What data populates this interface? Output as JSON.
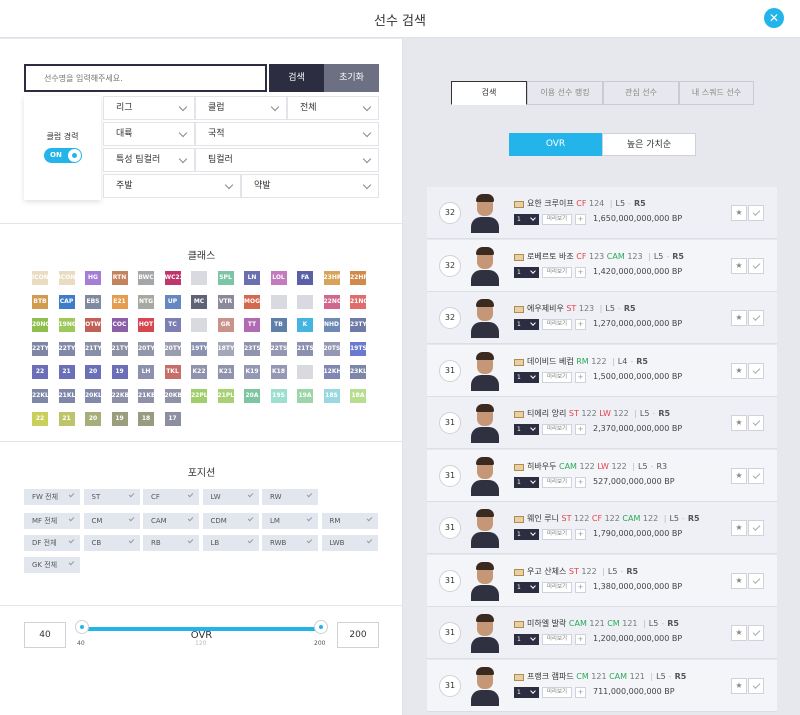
{
  "header": {
    "title": "선수 검색",
    "close_label": "✕"
  },
  "search": {
    "placeholder": "선수명을 입력해주세요.",
    "search_label": "검색",
    "reset_label": "초기화",
    "club_career_label": "클럽 경력",
    "club_career_toggle": "ON",
    "filters": {
      "league": "리그",
      "club": "클럽",
      "all": "전체",
      "continent": "대륙",
      "nationality": "국적",
      "special_team_color": "특성 팀컬러",
      "team_color": "팀컬러",
      "main_foot": "주발",
      "weak_foot": "약발"
    }
  },
  "class_section": {
    "title": "클래스",
    "badges": [
      {
        "label": "ICON",
        "color": "#e9dcc0"
      },
      {
        "label": "ICON",
        "color": "#e9dcc0"
      },
      {
        "label": "HG",
        "color": "#a67dd6"
      },
      {
        "label": "RTN",
        "color": "#c4825e"
      },
      {
        "label": "BWC",
        "color": "#a4a6a8"
      },
      {
        "label": "WC22",
        "color": "#c0356b"
      },
      {
        "label": "",
        "color": "#d9dadf"
      },
      {
        "label": "SPL",
        "color": "#7ec4a6"
      },
      {
        "label": "LN",
        "color": "#6870b0"
      },
      {
        "label": "LOL",
        "color": "#c27bbd"
      },
      {
        "label": "FA",
        "color": "#5a60a8"
      },
      {
        "label": "23HR",
        "color": "#d8a35a"
      },
      {
        "label": "22HR",
        "color": "#d08a4a"
      },
      {
        "label": "BTB",
        "color": "#d29a4e"
      },
      {
        "label": "CAP",
        "color": "#3e7cc8"
      },
      {
        "label": "EBS",
        "color": "#7f8aa0"
      },
      {
        "label": "E21",
        "color": "#e59e50"
      },
      {
        "label": "NTG",
        "color": "#a6a8a2"
      },
      {
        "label": "UP",
        "color": "#6488c2"
      },
      {
        "label": "MC",
        "color": "#5f6378"
      },
      {
        "label": "VTR",
        "color": "#8c8a9a"
      },
      {
        "label": "MOG",
        "color": "#d3694e"
      },
      {
        "label": "",
        "color": "#d9dadf"
      },
      {
        "label": "",
        "color": "#d9dadf"
      },
      {
        "label": "22NG",
        "color": "#d2678e"
      },
      {
        "label": "21NG",
        "color": "#e06c6c"
      },
      {
        "label": "20NG",
        "color": "#8fbf4b"
      },
      {
        "label": "19NG",
        "color": "#9fc85a"
      },
      {
        "label": "OTW",
        "color": "#c25f56"
      },
      {
        "label": "COC",
        "color": "#8b5ea8"
      },
      {
        "label": "HOT",
        "color": "#d6484f"
      },
      {
        "label": "TC",
        "color": "#7d7fb3"
      },
      {
        "label": "",
        "color": "#d9dadf"
      },
      {
        "label": "GR",
        "color": "#c9928a"
      },
      {
        "label": "TT",
        "color": "#b06bb3"
      },
      {
        "label": "TB",
        "color": "#5d7fa8"
      },
      {
        "label": "K",
        "color": "#44b4e0"
      },
      {
        "label": "NHD",
        "color": "#6f89b5"
      },
      {
        "label": "23TY",
        "color": "#6e7ba8"
      },
      {
        "label": "22TY",
        "color": "#7f86a2"
      },
      {
        "label": "22TY",
        "color": "#8188a8"
      },
      {
        "label": "21TY",
        "color": "#8890a8"
      },
      {
        "label": "21TY",
        "color": "#8a8fa4"
      },
      {
        "label": "20TY",
        "color": "#9196a8"
      },
      {
        "label": "20TY",
        "color": "#9a9cb0"
      },
      {
        "label": "19TY",
        "color": "#8a92b0"
      },
      {
        "label": "18TY",
        "color": "#a3a7b8"
      },
      {
        "label": "23TS",
        "color": "#8f93ad"
      },
      {
        "label": "22TS",
        "color": "#9497b2"
      },
      {
        "label": "21TS",
        "color": "#8c8fb0"
      },
      {
        "label": "20TS",
        "color": "#9598b5"
      },
      {
        "label": "19TS",
        "color": "#6a7ad0"
      },
      {
        "label": "22",
        "color": "#6a6fb8"
      },
      {
        "label": "21",
        "color": "#6a6fb8"
      },
      {
        "label": "20",
        "color": "#6a6fb8"
      },
      {
        "label": "19",
        "color": "#6a6fb8"
      },
      {
        "label": "LH",
        "color": "#8c91b0"
      },
      {
        "label": "TKL",
        "color": "#c76d6a"
      },
      {
        "label": "K22",
        "color": "#8f93ad"
      },
      {
        "label": "K21",
        "color": "#8f93ad"
      },
      {
        "label": "K19",
        "color": "#9598b5"
      },
      {
        "label": "K18",
        "color": "#9598b5"
      },
      {
        "label": "",
        "color": "#d9dadf"
      },
      {
        "label": "12KH",
        "color": "#7f87b2"
      },
      {
        "label": "23KL",
        "color": "#7c87a8"
      },
      {
        "label": "22KL",
        "color": "#7f87a8"
      },
      {
        "label": "21KL",
        "color": "#7f87a8"
      },
      {
        "label": "20KL",
        "color": "#8289ab"
      },
      {
        "label": "22KB",
        "color": "#8c8fa8"
      },
      {
        "label": "21KB",
        "color": "#8e91a8"
      },
      {
        "label": "20KB",
        "color": "#9093a8"
      },
      {
        "label": "22PL",
        "color": "#9fcf6b"
      },
      {
        "label": "21PL",
        "color": "#a6d273"
      },
      {
        "label": "20A",
        "color": "#7cc6a0"
      },
      {
        "label": "19S",
        "color": "#9ee0d0"
      },
      {
        "label": "19A",
        "color": "#9cd6a8"
      },
      {
        "label": "18S",
        "color": "#9ad8e0"
      },
      {
        "label": "18A",
        "color": "#b8dd8f"
      },
      {
        "label": "22",
        "color": "#c8d05a"
      },
      {
        "label": "21",
        "color": "#bdc46a"
      },
      {
        "label": "20",
        "color": "#a8ae7a"
      },
      {
        "label": "19",
        "color": "#9a9e7c"
      },
      {
        "label": "18",
        "color": "#999b80"
      },
      {
        "label": "17",
        "color": "#8c8fa0"
      }
    ]
  },
  "position_section": {
    "title": "포지션",
    "chips": [
      [
        "FW 전체",
        "ST",
        "CF",
        "LW",
        "RW"
      ],
      [
        "MF 전체",
        "CM",
        "CAM",
        "CDM",
        "LM",
        "RM"
      ],
      [
        "DF 전체",
        "CB",
        "RB",
        "LB",
        "RWB",
        "LWB"
      ],
      [
        "GK 전체"
      ]
    ]
  },
  "ovr_section": {
    "title": "OVR",
    "min_value": "40",
    "max_value": "200",
    "tick_min": "40",
    "tick_mid": "120",
    "tick_max": "200"
  },
  "tabs": [
    "검색",
    "이용 선수 랭킹",
    "관심 선수",
    "내 스쿼드 선수"
  ],
  "sort_toggle": {
    "ovr": "OVR",
    "value": "높은 가치순"
  },
  "players": [
    {
      "ovr": "32",
      "name": "요한 크루이프",
      "pos": [
        [
          "CF",
          "124"
        ]
      ],
      "level": "L5",
      "rank": "R5",
      "qty": "1",
      "preview": "미리보기",
      "price": "1,650,000,000,000 BP"
    },
    {
      "ovr": "32",
      "name": "로베르토 바조",
      "pos": [
        [
          "CF",
          "123"
        ],
        [
          "CAM",
          "123"
        ]
      ],
      "level": "L5",
      "rank": "R5",
      "qty": "1",
      "preview": "미리보기",
      "price": "1,420,000,000,000 BP"
    },
    {
      "ovr": "32",
      "name": "에우제비우",
      "pos": [
        [
          "ST",
          "123"
        ]
      ],
      "level": "L5",
      "rank": "R5",
      "qty": "1",
      "preview": "미리보기",
      "price": "1,270,000,000,000 BP"
    },
    {
      "ovr": "31",
      "name": "데이비드 베컴",
      "pos": [
        [
          "RM",
          "122"
        ]
      ],
      "level": "L4",
      "rank": "R5",
      "qty": "1",
      "preview": "미리보기",
      "price": "1,500,000,000,000 BP"
    },
    {
      "ovr": "31",
      "name": "티에리 앙리",
      "pos": [
        [
          "ST",
          "122"
        ],
        [
          "LW",
          "122"
        ]
      ],
      "level": "L5",
      "rank": "R5",
      "qty": "1",
      "preview": "미리보기",
      "price": "2,370,000,000,000 BP"
    },
    {
      "ovr": "31",
      "name": "히바우두",
      "pos": [
        [
          "CAM",
          "122"
        ],
        [
          "LW",
          "122"
        ]
      ],
      "level": "L5",
      "rank": "R3",
      "qty": "1",
      "preview": "미리보기",
      "price": "527,000,000,000 BP"
    },
    {
      "ovr": "31",
      "name": "웨인 루니",
      "pos": [
        [
          "ST",
          "122"
        ],
        [
          "CF",
          "122"
        ],
        [
          "CAM",
          "122"
        ]
      ],
      "level": "L5",
      "rank": "R5",
      "qty": "1",
      "preview": "미리보기",
      "price": "1,790,000,000,000 BP"
    },
    {
      "ovr": "31",
      "name": "우고 산체스",
      "pos": [
        [
          "ST",
          "122"
        ]
      ],
      "level": "L5",
      "rank": "R5",
      "qty": "1",
      "preview": "미리보기",
      "price": "1,380,000,000,000 BP"
    },
    {
      "ovr": "31",
      "name": "미하엘 발락",
      "pos": [
        [
          "CAM",
          "121"
        ],
        [
          "CM",
          "121"
        ]
      ],
      "level": "L5",
      "rank": "R5",
      "qty": "1",
      "preview": "미리보기",
      "price": "1,200,000,000,000 BP"
    },
    {
      "ovr": "31",
      "name": "프랭크 램파드",
      "pos": [
        [
          "CM",
          "121"
        ],
        [
          "CAM",
          "121"
        ]
      ],
      "level": "L5",
      "rank": "R5",
      "qty": "1",
      "preview": "미리보기",
      "price": "711,000,000,000 BP"
    }
  ],
  "colors": {
    "accent": "#23b5ea",
    "dark": "#2c2d40",
    "red_pos": "#e8404d",
    "green_pos": "#2aa85a"
  }
}
